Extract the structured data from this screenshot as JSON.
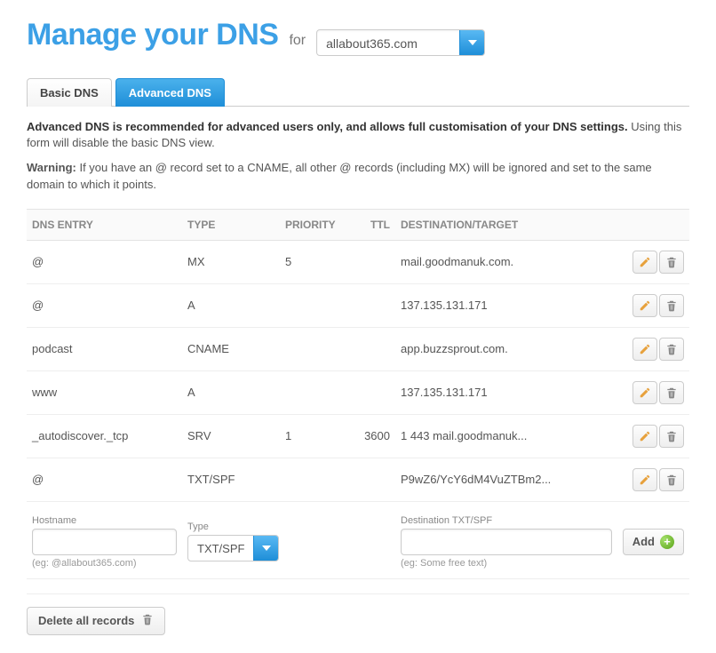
{
  "header": {
    "title": "Manage your DNS",
    "for_label": "for",
    "domain_selected": "allabout365.com"
  },
  "tabs": {
    "basic": "Basic DNS",
    "advanced": "Advanced DNS"
  },
  "intro": {
    "bold": "Advanced DNS is recommended for advanced users only, and allows full customisation of your DNS settings.",
    "rest": "Using this form will disable the basic DNS view."
  },
  "warning": {
    "label": "Warning:",
    "text": "If you have an @ record set to a CNAME, all other @ records (including MX) will be ignored and set to the same domain to which it points."
  },
  "columns": {
    "entry": "DNS ENTRY",
    "type": "TYPE",
    "priority": "PRIORITY",
    "ttl": "TTL",
    "dest": "DESTINATION/TARGET"
  },
  "rows": [
    {
      "entry": "@",
      "type": "MX",
      "priority": "5",
      "ttl": "",
      "dest": "mail.goodmanuk.com."
    },
    {
      "entry": "@",
      "type": "A",
      "priority": "",
      "ttl": "",
      "dest": "137.135.131.171"
    },
    {
      "entry": "podcast",
      "type": "CNAME",
      "priority": "",
      "ttl": "",
      "dest": "app.buzzsprout.com."
    },
    {
      "entry": "www",
      "type": "A",
      "priority": "",
      "ttl": "",
      "dest": "137.135.131.171"
    },
    {
      "entry": "_autodiscover._tcp",
      "type": "SRV",
      "priority": "1",
      "ttl": "3600",
      "dest": "1 443 mail.goodmanuk..."
    },
    {
      "entry": "@",
      "type": "TXT/SPF",
      "priority": "",
      "ttl": "",
      "dest": "P9wZ6/YcY6dM4VuZTBm2..."
    }
  ],
  "add_form": {
    "hostname_label": "Hostname",
    "hostname_hint": "(eg: @allabout365.com)",
    "type_label": "Type",
    "type_selected": "TXT/SPF",
    "dest_label": "Destination TXT/SPF",
    "dest_hint": "(eg: Some free text)",
    "add_button": "Add"
  },
  "footer": {
    "delete_all": "Delete all records"
  }
}
